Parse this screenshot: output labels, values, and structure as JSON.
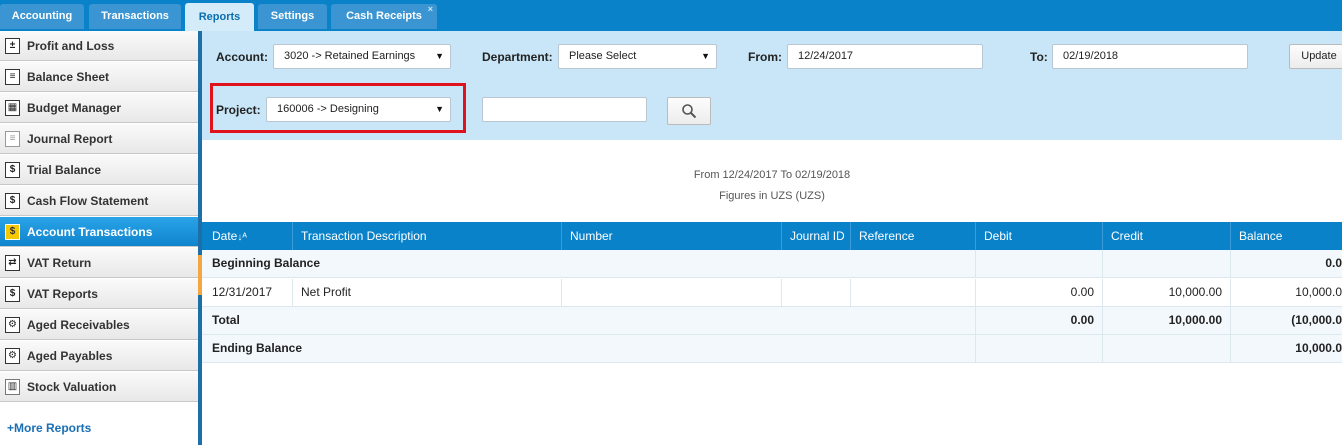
{
  "tabs": [
    {
      "label": "Accounting",
      "active": false
    },
    {
      "label": "Transactions",
      "active": false
    },
    {
      "label": "Reports",
      "active": true
    },
    {
      "label": "Settings",
      "active": false
    },
    {
      "label": "Cash Receipts",
      "active": false
    }
  ],
  "tab_close_glyph": "×",
  "sidebar": {
    "items": [
      {
        "label": "Profit and Loss",
        "icon": "profit-loss-icon"
      },
      {
        "label": "Balance Sheet",
        "icon": "balance-sheet-icon"
      },
      {
        "label": "Budget Manager",
        "icon": "budget-icon"
      },
      {
        "label": "Journal Report",
        "icon": "journal-icon"
      },
      {
        "label": "Trial Balance",
        "icon": "dollar-document-icon"
      },
      {
        "label": "Cash Flow Statement",
        "icon": "dollar-document-icon"
      },
      {
        "label": "Account Transactions",
        "icon": "account-transactions-icon",
        "active": true
      },
      {
        "label": "VAT Return",
        "icon": "vat-return-icon"
      },
      {
        "label": "VAT Reports",
        "icon": "vat-reports-icon"
      },
      {
        "label": "Aged Receivables",
        "icon": "aged-receivables-icon"
      },
      {
        "label": "Aged Payables",
        "icon": "aged-payables-icon"
      },
      {
        "label": "Stock Valuation",
        "icon": "stock-valuation-icon"
      }
    ],
    "more_link": "+More Reports"
  },
  "filters": {
    "account_label": "Account:",
    "account_value": "3020 -> Retained Earnings",
    "department_label": "Department:",
    "department_value": "Please Select",
    "from_label": "From:",
    "from_value": "12/24/2017",
    "to_label": "To:",
    "to_value": "02/19/2018",
    "update_label": "Update",
    "project_label": "Project:",
    "project_value": "160006 -> Designing",
    "search_value": ""
  },
  "report": {
    "date_range": "From 12/24/2017 To 02/19/2018",
    "figures": "Figures in UZS (UZS)"
  },
  "table": {
    "headers": [
      "Date",
      "Transaction Description",
      "Number",
      "Journal ID",
      "Reference",
      "Debit",
      "Credit",
      "Balance"
    ],
    "rows": [
      {
        "date": "Beginning Balance",
        "description": "",
        "number": "",
        "journal_id": "",
        "reference": "",
        "debit": "",
        "credit": "",
        "balance": "0.0",
        "bold": true,
        "merged": true
      },
      {
        "date": "12/31/2017",
        "description": "Net Profit",
        "number": "",
        "journal_id": "",
        "reference": "",
        "debit": "0.00",
        "credit": "10,000.00",
        "balance": "10,000.0",
        "bold": false,
        "merged": false
      },
      {
        "date": "Total",
        "description": "",
        "number": "",
        "journal_id": "",
        "reference": "",
        "debit": "0.00",
        "credit": "10,000.00",
        "balance": "(10,000.0",
        "bold": true,
        "merged": true
      },
      {
        "date": "Ending Balance",
        "description": "",
        "number": "",
        "journal_id": "",
        "reference": "",
        "debit": "",
        "credit": "",
        "balance": "10,000.0",
        "bold": true,
        "merged": true
      }
    ]
  },
  "colors": {
    "accent": "#0a82c9",
    "filter_bg": "#c8e6f7",
    "highlight": "#e0131c"
  }
}
